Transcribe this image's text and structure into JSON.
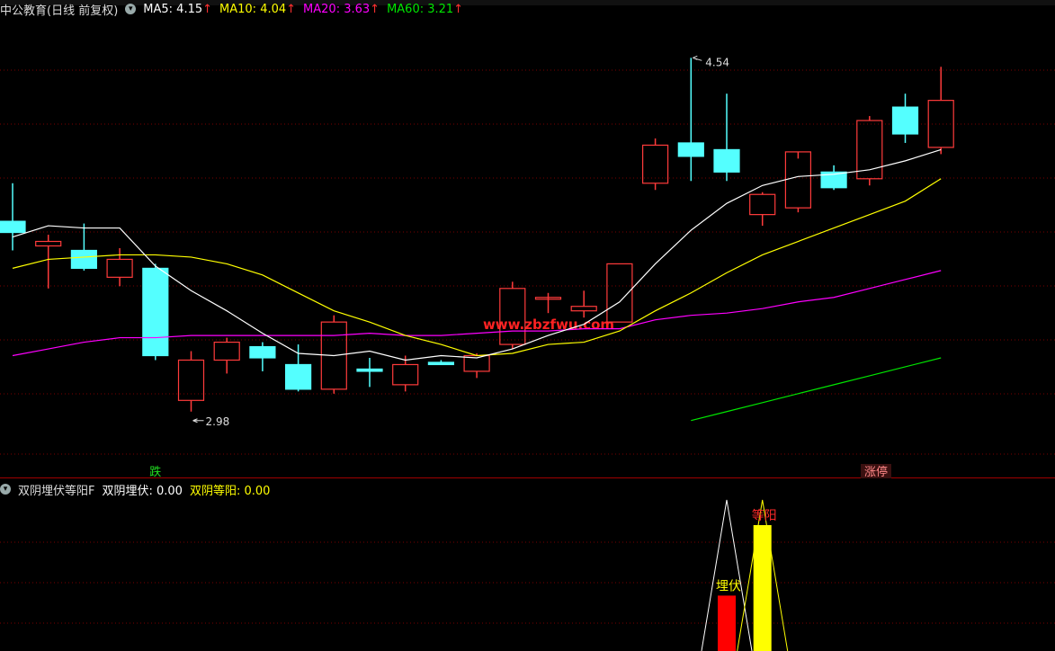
{
  "stock_header": {
    "title": "中公教育(日线 前复权)",
    "ma_items": [
      {
        "label": "MA5: 4.15",
        "color": "#ffffff"
      },
      {
        "label": "MA10: 4.04",
        "color": "#ffff00"
      },
      {
        "label": "MA20: 3.63",
        "color": "#ff00ff"
      },
      {
        "label": "MA60: 3.21",
        "color": "#00e600"
      }
    ],
    "up_arrow": "↑"
  },
  "indicator_header": {
    "name": "双阴埋伏等阳F",
    "value1": "双阴埋伏: 0.00",
    "value2": "双阴等阳: 0.00"
  },
  "colors": {
    "background": "#000000",
    "up": "#ff3b3b",
    "down": "#54ffff",
    "grid": "#7a0000",
    "ma5": "#ffffff",
    "ma10": "#ffff00",
    "ma20": "#ff00ff",
    "ma60": "#00e600"
  },
  "chart_data": [
    {
      "type": "candlestick",
      "ylim": [
        2.75,
        4.75
      ],
      "annotations": {
        "high_label": "4.54",
        "low_label": "2.98",
        "fall_tag": "跌",
        "limit_up_tag": "涨停"
      },
      "watermark": "www.zbzfwu.com",
      "candles": [
        {
          "o": 3.85,
          "h": 4.02,
          "l": 3.72,
          "c": 3.8
        },
        {
          "o": 3.74,
          "h": 3.79,
          "l": 3.55,
          "c": 3.76
        },
        {
          "o": 3.72,
          "h": 3.84,
          "l": 3.63,
          "c": 3.64
        },
        {
          "o": 3.6,
          "h": 3.73,
          "l": 3.56,
          "c": 3.68
        },
        {
          "o": 3.64,
          "h": 3.66,
          "l": 3.23,
          "c": 3.25
        },
        {
          "o": 3.05,
          "h": 3.27,
          "l": 3.0,
          "c": 3.23
        },
        {
          "o": 3.23,
          "h": 3.33,
          "l": 3.17,
          "c": 3.31
        },
        {
          "o": 3.29,
          "h": 3.31,
          "l": 3.18,
          "c": 3.24
        },
        {
          "o": 3.21,
          "h": 3.3,
          "l": 3.09,
          "c": 3.1
        },
        {
          "o": 3.1,
          "h": 3.43,
          "l": 3.08,
          "c": 3.4
        },
        {
          "o": 3.19,
          "h": 3.24,
          "l": 3.11,
          "c": 3.18
        },
        {
          "o": 3.12,
          "h": 3.25,
          "l": 3.09,
          "c": 3.21
        },
        {
          "o": 3.22,
          "h": 3.23,
          "l": 3.21,
          "c": 3.21
        },
        {
          "o": 3.18,
          "h": 3.26,
          "l": 3.15,
          "c": 3.25
        },
        {
          "o": 3.3,
          "h": 3.58,
          "l": 3.28,
          "c": 3.55
        },
        {
          "o": 3.51,
          "h": 3.53,
          "l": 3.44,
          "c": 3.51
        },
        {
          "o": 3.45,
          "h": 3.54,
          "l": 3.42,
          "c": 3.47
        },
        {
          "o": 3.4,
          "h": 3.66,
          "l": 3.4,
          "c": 3.66
        },
        {
          "o": 4.02,
          "h": 4.22,
          "l": 3.99,
          "c": 4.19
        },
        {
          "o": 4.2,
          "h": 4.58,
          "l": 4.03,
          "c": 4.14
        },
        {
          "o": 4.17,
          "h": 4.42,
          "l": 4.03,
          "c": 4.07
        },
        {
          "o": 3.88,
          "h": 3.98,
          "l": 3.83,
          "c": 3.97
        },
        {
          "o": 3.91,
          "h": 4.13,
          "l": 3.89,
          "c": 4.16
        },
        {
          "o": 4.07,
          "h": 4.1,
          "l": 3.99,
          "c": 4.0
        },
        {
          "o": 4.04,
          "h": 4.32,
          "l": 4.01,
          "c": 4.3
        },
        {
          "o": 4.36,
          "h": 4.42,
          "l": 4.2,
          "c": 4.24
        },
        {
          "o": 4.18,
          "h": 4.54,
          "l": 4.15,
          "c": 4.39
        }
      ],
      "ma5": [
        3.78,
        3.83,
        3.82,
        3.82,
        3.65,
        3.54,
        3.45,
        3.35,
        3.26,
        3.25,
        3.27,
        3.23,
        3.25,
        3.24,
        3.28,
        3.34,
        3.39,
        3.49,
        3.66,
        3.81,
        3.93,
        4.01,
        4.05,
        4.06,
        4.08,
        4.12,
        4.17
      ],
      "ma10": [
        3.64,
        3.68,
        3.69,
        3.7,
        3.7,
        3.69,
        3.66,
        3.61,
        3.53,
        3.45,
        3.4,
        3.34,
        3.3,
        3.25,
        3.26,
        3.3,
        3.31,
        3.36,
        3.45,
        3.53,
        3.62,
        3.7,
        3.76,
        3.82,
        3.88,
        3.94,
        4.04
      ],
      "ma20": [
        3.25,
        3.28,
        3.31,
        3.33,
        3.33,
        3.34,
        3.34,
        3.34,
        3.34,
        3.34,
        3.35,
        3.34,
        3.34,
        3.35,
        3.36,
        3.36,
        3.37,
        3.37,
        3.41,
        3.43,
        3.44,
        3.46,
        3.49,
        3.51,
        3.55,
        3.59,
        3.63
      ],
      "ma60": [
        null,
        null,
        null,
        null,
        null,
        null,
        null,
        null,
        null,
        null,
        null,
        null,
        null,
        null,
        null,
        null,
        null,
        null,
        null,
        2.96,
        3.0,
        3.04,
        3.08,
        3.12,
        3.16,
        3.2,
        3.24
      ]
    },
    {
      "type": "indicator",
      "signal_labels": {
        "buried": "埋伏",
        "wait_yang": "等阳"
      },
      "bars": [
        {
          "index": 20,
          "value": 0.55,
          "color": "#ff0000"
        },
        {
          "index": 21,
          "value": 1.25,
          "color": "#ffff00"
        }
      ]
    }
  ]
}
